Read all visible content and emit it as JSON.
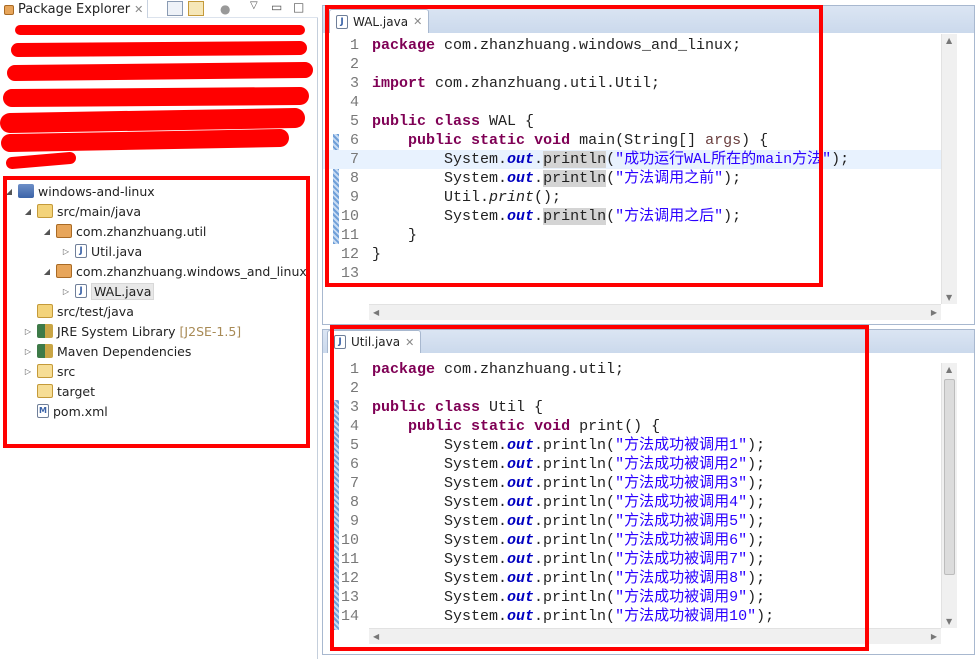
{
  "package_explorer": {
    "title": "Package Explorer",
    "tree": [
      {
        "label": "windows-and-linux",
        "icon": "maven-project-icon",
        "twisty": "expanded",
        "level": 0
      },
      {
        "label": "src/main/java",
        "icon": "source-folder-icon",
        "twisty": "expanded",
        "level": 1
      },
      {
        "label": "com.zhanzhuang.util",
        "icon": "package-icon",
        "twisty": "expanded",
        "level": 2
      },
      {
        "label": "Util.java",
        "icon": "java-file-icon",
        "twisty": "collapsed",
        "level": 3
      },
      {
        "label": "com.zhanzhuang.windows_and_linux",
        "icon": "package-icon",
        "twisty": "expanded",
        "level": 2
      },
      {
        "label": "WAL.java",
        "icon": "java-file-icon",
        "twisty": "collapsed",
        "level": 3,
        "selected": true
      },
      {
        "label": "src/test/java",
        "icon": "source-folder-icon",
        "twisty": "none",
        "level": 1
      },
      {
        "label": "JRE System Library",
        "decoration": "[J2SE-1.5]",
        "icon": "library-icon",
        "twisty": "collapsed",
        "level": 1
      },
      {
        "label": "Maven Dependencies",
        "icon": "library-icon",
        "twisty": "collapsed",
        "level": 1
      },
      {
        "label": "src",
        "icon": "folder-icon",
        "twisty": "collapsed",
        "level": 1
      },
      {
        "label": "target",
        "icon": "folder-icon",
        "twisty": "none",
        "level": 1
      },
      {
        "label": "pom.xml",
        "icon": "xml-file-icon",
        "twisty": "none",
        "level": 1
      }
    ]
  },
  "editors": [
    {
      "tab": "WAL.java",
      "current_line": 7,
      "lines": [
        [
          [
            "k",
            "package"
          ],
          [
            "p",
            " com.zhanzhuang.windows_and_linux;"
          ]
        ],
        [],
        [
          [
            "k",
            "import"
          ],
          [
            "p",
            " com.zhanzhuang.util.Util;"
          ]
        ],
        [],
        [
          [
            "k",
            "public"
          ],
          [
            "p",
            " "
          ],
          [
            "k",
            "class"
          ],
          [
            "p",
            " WAL {"
          ]
        ],
        [
          [
            "p",
            "    "
          ],
          [
            "k",
            "public"
          ],
          [
            "p",
            " "
          ],
          [
            "k",
            "static"
          ],
          [
            "p",
            " "
          ],
          [
            "k",
            "void"
          ],
          [
            "p",
            " main(String[] "
          ],
          [
            "a",
            "args"
          ],
          [
            "p",
            ") {"
          ]
        ],
        [
          [
            "p",
            "        System."
          ],
          [
            "f",
            "out"
          ],
          [
            "p",
            "."
          ],
          [
            "m",
            "println"
          ],
          [
            "p",
            "("
          ],
          [
            "s",
            "\"成功运行WAL所在的main方法\""
          ],
          [
            "p",
            ");"
          ]
        ],
        [
          [
            "p",
            "        System."
          ],
          [
            "f",
            "out"
          ],
          [
            "p",
            "."
          ],
          [
            "m",
            "println"
          ],
          [
            "p",
            "("
          ],
          [
            "s",
            "\"方法调用之前\""
          ],
          [
            "p",
            ");"
          ]
        ],
        [
          [
            "p",
            "        Util."
          ],
          [
            "i",
            "print"
          ],
          [
            "p",
            "();"
          ]
        ],
        [
          [
            "p",
            "        System."
          ],
          [
            "f",
            "out"
          ],
          [
            "p",
            "."
          ],
          [
            "m",
            "println"
          ],
          [
            "p",
            "("
          ],
          [
            "s",
            "\"方法调用之后\""
          ],
          [
            "p",
            ");"
          ]
        ],
        [
          [
            "p",
            "    }"
          ]
        ],
        [
          [
            "p",
            "}"
          ]
        ],
        []
      ]
    },
    {
      "tab": "Util.java",
      "lines": [
        [
          [
            "k",
            "package"
          ],
          [
            "p",
            " com.zhanzhuang.util;"
          ]
        ],
        [],
        [
          [
            "k",
            "public"
          ],
          [
            "p",
            " "
          ],
          [
            "k",
            "class"
          ],
          [
            "p",
            " Util {"
          ]
        ],
        [
          [
            "p",
            "    "
          ],
          [
            "k",
            "public"
          ],
          [
            "p",
            " "
          ],
          [
            "k",
            "static"
          ],
          [
            "p",
            " "
          ],
          [
            "k",
            "void"
          ],
          [
            "p",
            " print() {"
          ]
        ],
        [
          [
            "p",
            "        System."
          ],
          [
            "f",
            "out"
          ],
          [
            "p",
            ".println("
          ],
          [
            "s",
            "\"方法成功被调用1\""
          ],
          [
            "p",
            ");"
          ]
        ],
        [
          [
            "p",
            "        System."
          ],
          [
            "f",
            "out"
          ],
          [
            "p",
            ".println("
          ],
          [
            "s",
            "\"方法成功被调用2\""
          ],
          [
            "p",
            ");"
          ]
        ],
        [
          [
            "p",
            "        System."
          ],
          [
            "f",
            "out"
          ],
          [
            "p",
            ".println("
          ],
          [
            "s",
            "\"方法成功被调用3\""
          ],
          [
            "p",
            ");"
          ]
        ],
        [
          [
            "p",
            "        System."
          ],
          [
            "f",
            "out"
          ],
          [
            "p",
            ".println("
          ],
          [
            "s",
            "\"方法成功被调用4\""
          ],
          [
            "p",
            ");"
          ]
        ],
        [
          [
            "p",
            "        System."
          ],
          [
            "f",
            "out"
          ],
          [
            "p",
            ".println("
          ],
          [
            "s",
            "\"方法成功被调用5\""
          ],
          [
            "p",
            ");"
          ]
        ],
        [
          [
            "p",
            "        System."
          ],
          [
            "f",
            "out"
          ],
          [
            "p",
            ".println("
          ],
          [
            "s",
            "\"方法成功被调用6\""
          ],
          [
            "p",
            ");"
          ]
        ],
        [
          [
            "p",
            "        System."
          ],
          [
            "f",
            "out"
          ],
          [
            "p",
            ".println("
          ],
          [
            "s",
            "\"方法成功被调用7\""
          ],
          [
            "p",
            ");"
          ]
        ],
        [
          [
            "p",
            "        System."
          ],
          [
            "f",
            "out"
          ],
          [
            "p",
            ".println("
          ],
          [
            "s",
            "\"方法成功被调用8\""
          ],
          [
            "p",
            ");"
          ]
        ],
        [
          [
            "p",
            "        System."
          ],
          [
            "f",
            "out"
          ],
          [
            "p",
            ".println("
          ],
          [
            "s",
            "\"方法成功被调用9\""
          ],
          [
            "p",
            ");"
          ]
        ],
        [
          [
            "p",
            "        System."
          ],
          [
            "f",
            "out"
          ],
          [
            "p",
            ".println("
          ],
          [
            "s",
            "\"方法成功被调用10\""
          ],
          [
            "p",
            ");"
          ]
        ]
      ]
    }
  ],
  "colors": {
    "annotation_red": "#ff0000",
    "keyword": "#7f0055",
    "string": "#2a00ff",
    "static_field": "#0000c0"
  }
}
